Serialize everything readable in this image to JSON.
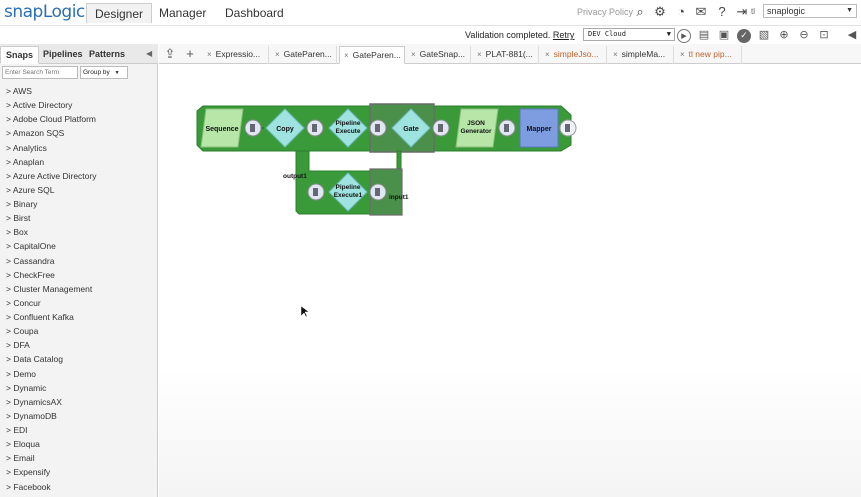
{
  "app": {
    "logo": "snapLogic",
    "nav": [
      "Designer",
      "Manager",
      "Dashboard"
    ],
    "privacy_link": "Privacy Policy",
    "org_prefix": "tl",
    "org": "snaplogic"
  },
  "toolbar": {
    "validation_text": "Validation completed.",
    "retry_label": "Retry",
    "environment": "DEV Cloud"
  },
  "sidebar": {
    "tabs": [
      "Snaps",
      "Pipelines",
      "Patterns"
    ],
    "search_placeholder": "Enter Search Term",
    "groupby_label": "Group by",
    "categories": [
      "> AWS",
      "> Active Directory",
      "> Adobe Cloud Platform",
      "> Amazon SQS",
      "> Analytics",
      "> Anaplan",
      "> Azure Active Directory",
      "> Azure SQL",
      "> Binary",
      "> Birst",
      "> Box",
      "> CapitalOne",
      "> Cassandra",
      "> CheckFree",
      "> Cluster Management",
      "> Concur",
      "> Confluent Kafka",
      "> Coupa",
      "> DFA",
      "> Data Catalog",
      "> Demo",
      "> Dynamic",
      "> DynamicsAX",
      "> DynamoDB",
      "> EDI",
      "> Eloqua",
      "> Email",
      "> Expensify",
      "> Facebook"
    ]
  },
  "pipeline_tabs": [
    {
      "label": "Expressio...",
      "active": false,
      "modified": false
    },
    {
      "label": "GateParen...",
      "active": false,
      "modified": false
    },
    {
      "label": "GateParen...",
      "active": true,
      "modified": false
    },
    {
      "label": "GateSnap...",
      "active": false,
      "modified": false
    },
    {
      "label": "PLAT-881(...",
      "active": false,
      "modified": false
    },
    {
      "label": "simpleJso...",
      "active": false,
      "modified": true
    },
    {
      "label": "simpleMa...",
      "active": false,
      "modified": false
    },
    {
      "label": "tl new pip...",
      "active": false,
      "modified": true
    }
  ],
  "pipeline": {
    "snaps": {
      "sequence": "Sequence",
      "copy": "Copy",
      "pipeline_execute": "Pipeline Execute",
      "gate": "Gate",
      "json_generator": "JSON Generator",
      "mapper": "Mapper",
      "pipeline_execute1": "Pipeline Execute1"
    },
    "views": {
      "output1": "output1",
      "input1": "input1"
    }
  },
  "colors": {
    "pipeline_green": "#3a9a3a",
    "pipeline_dark_green": "#2e7d2e",
    "snap_light_green": "#b7e6a8",
    "snap_cyan": "#9fe3e0",
    "snap_blue": "#7d9de0",
    "modified_tab": "#c0622a"
  }
}
